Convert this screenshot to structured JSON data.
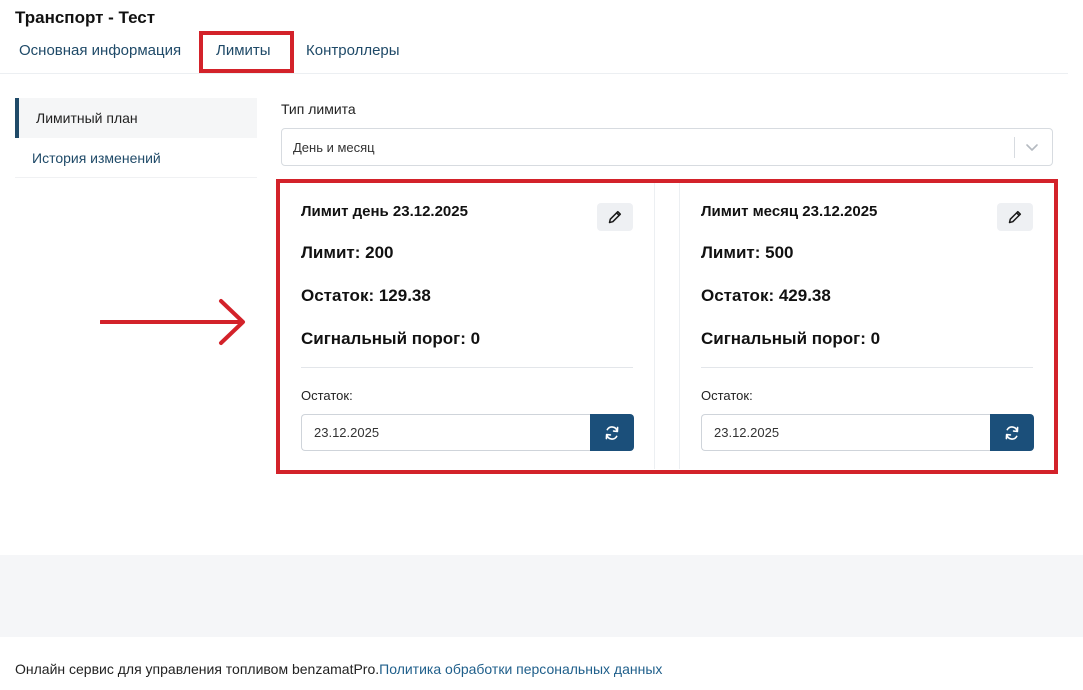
{
  "header": {
    "title": "Транспорт - Тест"
  },
  "tabs": [
    {
      "label": "Основная информация"
    },
    {
      "label": "Лимиты"
    },
    {
      "label": "Контроллеры"
    }
  ],
  "sidebar": {
    "items": [
      {
        "label": "Лимитный план",
        "active": true
      },
      {
        "label": "История изменений",
        "active": false
      }
    ]
  },
  "limit_type": {
    "label": "Тип лимита",
    "selected": "День и месяц"
  },
  "cards": [
    {
      "title": "Лимит день 23.12.2025",
      "limit": "Лимит: 200",
      "remainder": "Остаток: 129.38",
      "threshold": "Сигнальный порог: 0",
      "rest_label": "Остаток:",
      "date_value": "23.12.2025"
    },
    {
      "title": "Лимит месяц 23.12.2025",
      "limit": "Лимит: 500",
      "remainder": "Остаток: 429.38",
      "threshold": "Сигнальный порог: 0",
      "rest_label": "Остаток:",
      "date_value": "23.12.2025"
    }
  ],
  "footer": {
    "text": "Онлайн сервис для управления топливом benzamatPro.",
    "link": "Политика обработки персональных данных"
  },
  "colors": {
    "accent": "#1b4f7a",
    "highlight": "#d3222a",
    "link": "#1f4a68"
  },
  "icons": [
    "pencil-icon",
    "refresh-icon",
    "chevron-down-icon",
    "arrow-right-icon"
  ]
}
